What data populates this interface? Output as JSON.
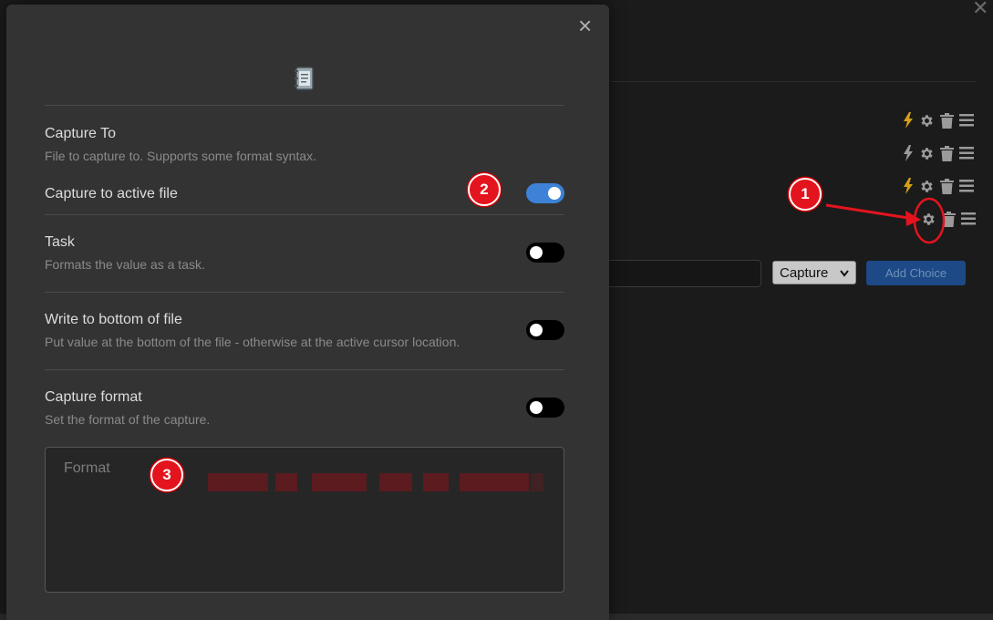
{
  "background": {
    "choice_rows": [
      {
        "bolt": true
      },
      {
        "bolt": true
      },
      {
        "bolt": true
      },
      {
        "bolt": false
      }
    ],
    "choice_type_select": "Capture",
    "add_choice_button": "Add Choice"
  },
  "modal": {
    "close_label": "×",
    "settings": [
      {
        "name": "Capture To",
        "desc": "File to capture to. Supports some format syntax."
      },
      {
        "name": "Capture to active file",
        "toggle": true
      },
      {
        "name": "Task",
        "desc": "Formats the value as a task.",
        "toggle": false
      },
      {
        "name": "Write to bottom of file",
        "desc": "Put value at the bottom of the file - otherwise at the active cursor location.",
        "toggle": false
      },
      {
        "name": "Capture format",
        "desc": "Set the format of the capture.",
        "toggle": false
      }
    ],
    "format_placeholder": "Format"
  },
  "annotations": {
    "badge_1": "1",
    "badge_2": "2",
    "badge_3": "3"
  },
  "colors": {
    "accent_toggle": "#3d82d6",
    "bolt": "#d4a017",
    "annotation_red": "#e3141e"
  }
}
